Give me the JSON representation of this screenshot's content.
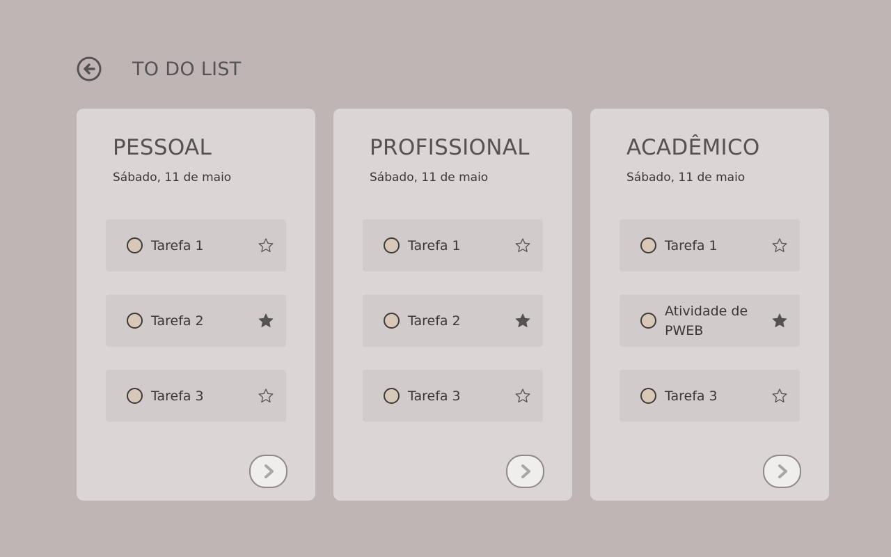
{
  "header": {
    "title": "TO DO LIST",
    "back_icon": "arrow-left-circle-icon"
  },
  "colors": {
    "background": "#bfb5b4",
    "card": "#dbd5d5",
    "item": "#d1cbcb",
    "checkbox": "#d8c8b7",
    "star": "#555252"
  },
  "lists": [
    {
      "title": "PESSOAL",
      "date": "Sábado,  11 de maio",
      "tasks": [
        {
          "label": "Tarefa 1",
          "starred": false
        },
        {
          "label": "Tarefa 2",
          "starred": true
        },
        {
          "label": "Tarefa 3",
          "starred": false
        }
      ]
    },
    {
      "title": "PROFISSIONAL",
      "date": "Sábado,  11 de maio",
      "tasks": [
        {
          "label": "Tarefa 1",
          "starred": false
        },
        {
          "label": "Tarefa 2",
          "starred": true
        },
        {
          "label": "Tarefa 3",
          "starred": false
        }
      ]
    },
    {
      "title": "ACADÊMICO",
      "date": "Sábado,  11 de maio",
      "tasks": [
        {
          "label": "Tarefa 1",
          "starred": false
        },
        {
          "label": "Atividade de PWEB",
          "starred": true
        },
        {
          "label": "Tarefa 3",
          "starred": false
        }
      ]
    }
  ]
}
